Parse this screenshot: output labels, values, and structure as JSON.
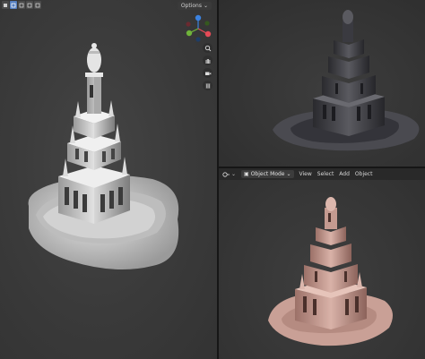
{
  "left_viewport": {
    "options_label": "Options",
    "toolbar_icons": [
      "object-mode-icon",
      "select-box-icon",
      "select-box-2-icon",
      "select-box-3-icon",
      "select-box-4-icon"
    ],
    "nav_icons": [
      "zoom-icon",
      "pan-hand-icon",
      "camera-view-icon",
      "grid-view-icon"
    ],
    "gizmo_axes": [
      "x-axis",
      "y-axis",
      "z-axis"
    ]
  },
  "bottom_right_viewport": {
    "mode_label": "Object Mode",
    "menu": [
      "View",
      "Select",
      "Add",
      "Object"
    ]
  },
  "colors": {
    "background": "#3a3a3a",
    "clay_gray": "#cfcfcf",
    "clay_dark": "#3b3b3f",
    "clay_pink": "#caa096",
    "axis_red": "#e44a57",
    "axis_green": "#6fb33a",
    "axis_blue": "#3b82e0"
  }
}
